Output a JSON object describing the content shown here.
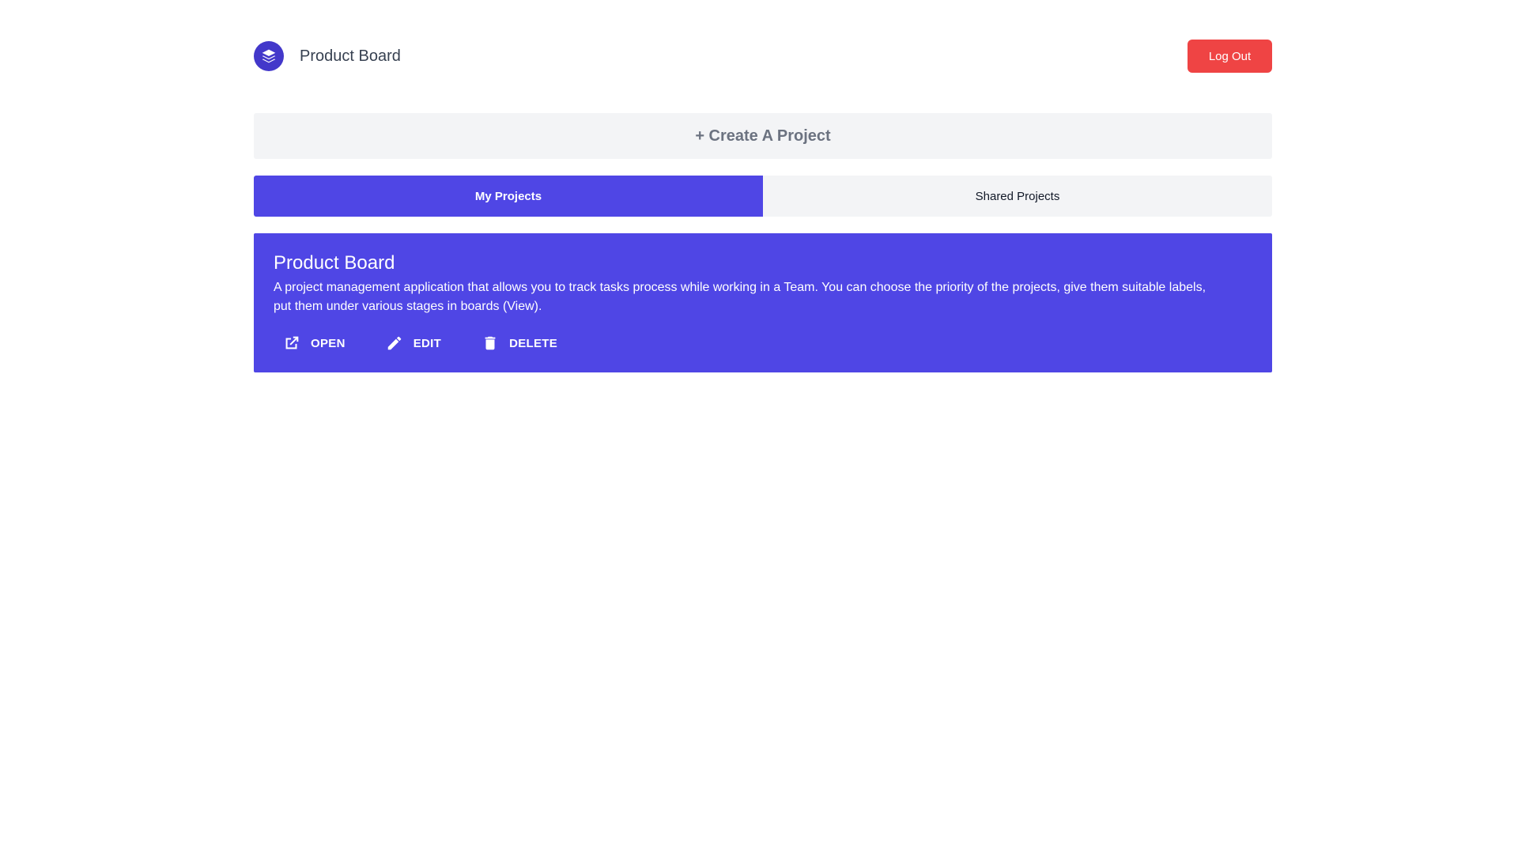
{
  "header": {
    "app_title": "Product Board",
    "logout_label": "Log Out",
    "logo_icon": "layers-icon"
  },
  "create_project": {
    "label": "+ Create A Project"
  },
  "tabs": [
    {
      "label": "My Projects",
      "active": true
    },
    {
      "label": "Shared Projects",
      "active": false
    }
  ],
  "projects": [
    {
      "title": "Product Board",
      "description": "A project management application that allows you to track tasks process while working in a Team. You can choose the priority of the projects, give them suitable labels, put them under various stages in boards (View).",
      "actions": [
        {
          "label": "OPEN",
          "icon": "open-in-new-icon"
        },
        {
          "label": "EDIT",
          "icon": "pencil-icon"
        },
        {
          "label": "DELETE",
          "icon": "trash-icon"
        }
      ]
    }
  ],
  "colors": {
    "accent": "#4f46e5",
    "logo": "#4338ca",
    "danger": "#ef4444",
    "surface": "#f3f4f6"
  }
}
